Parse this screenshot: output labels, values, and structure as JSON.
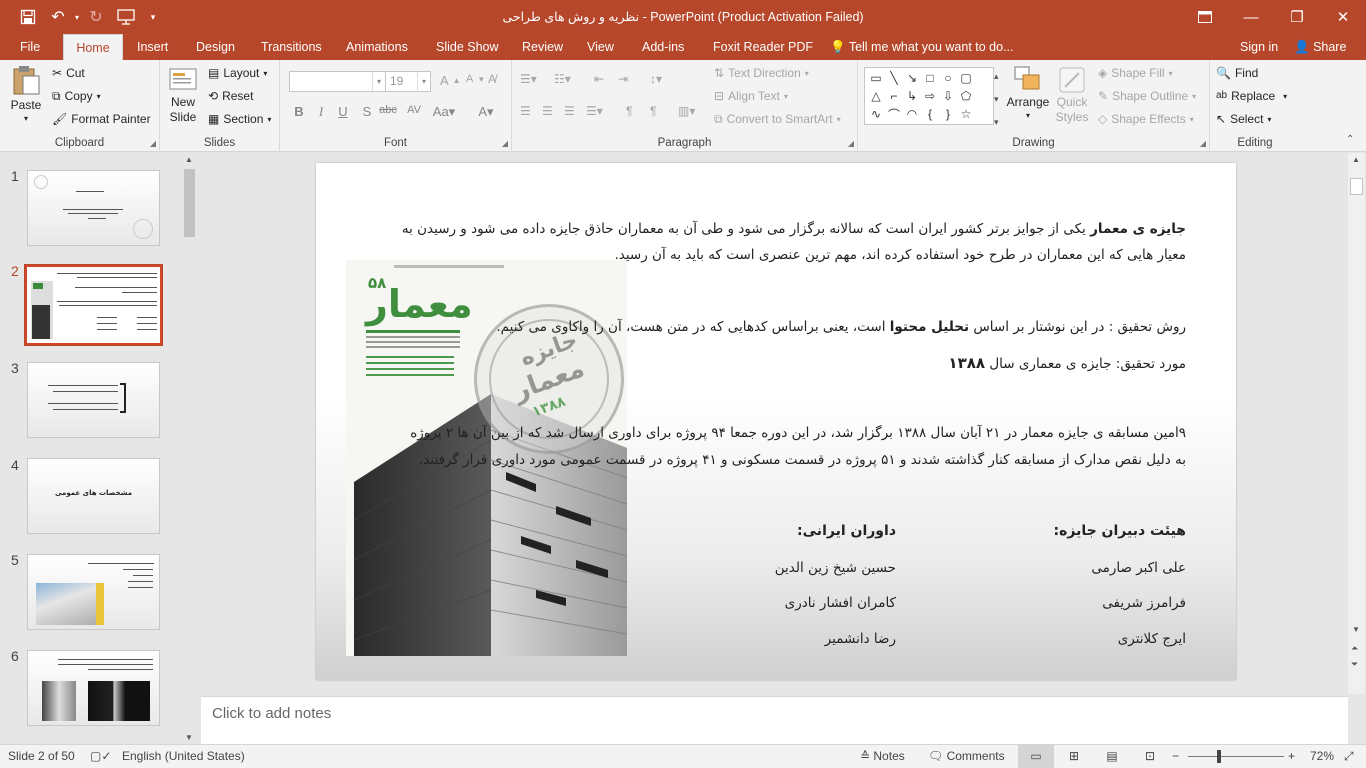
{
  "window": {
    "title": "نظریه و روش های طراحی - PowerPoint (Product Activation Failed)",
    "accent": "#b7472a"
  },
  "tabs": {
    "file": "File",
    "items": [
      "Home",
      "Insert",
      "Design",
      "Transitions",
      "Animations",
      "Slide Show",
      "Review",
      "View",
      "Add-ins",
      "Foxit Reader PDF"
    ],
    "active": "Home",
    "tell_me": "Tell me what you want to do...",
    "sign_in": "Sign in",
    "share": "Share"
  },
  "ribbon": {
    "clipboard": {
      "label": "Clipboard",
      "paste": "Paste",
      "cut": "Cut",
      "copy": "Copy",
      "format_painter": "Format Painter"
    },
    "slides": {
      "label": "Slides",
      "new_slide_1": "New",
      "new_slide_2": "Slide",
      "layout": "Layout",
      "reset": "Reset",
      "section": "Section"
    },
    "font": {
      "label": "Font",
      "size": "19",
      "font_name": ""
    },
    "paragraph": {
      "label": "Paragraph",
      "text_direction": "Text Direction",
      "align_text": "Align Text",
      "smartart": "Convert to SmartArt"
    },
    "drawing": {
      "label": "Drawing",
      "arrange": "Arrange",
      "quick_1": "Quick",
      "quick_2": "Styles",
      "shape_fill": "Shape Fill",
      "shape_outline": "Shape Outline",
      "shape_effects": "Shape Effects"
    },
    "editing": {
      "label": "Editing",
      "find": "Find",
      "replace": "Replace",
      "select": "Select"
    }
  },
  "thumbnails": {
    "numbers": [
      "1",
      "2",
      "3",
      "4",
      "5",
      "6"
    ],
    "selected": "2",
    "slide4_title": "مشخصات های عمومی"
  },
  "slide": {
    "p1_bold": "جایزه ی معمار",
    "p1_rest": " یکی از جوایز برتر کشور ایران است که سالانه  برگزار می شود و طی آن به معماران حاذق جایزه داده می شود و رسیدن به",
    "p1_line2": "معیار هایی که این معماران در طرح خود استفاده کرده اند، مهم ترین عنصری است که باید به آن رسید.",
    "p2_a": "روش تحقیق : در این نوشتار بر اساس ",
    "p2_bold": "تحلیل محتوا",
    "p2_b": " است، یعنی براساس کدهایی که در متن هست، آن را واکاوی می کنیم.",
    "p3_a": "مورد تحقیق: جایزه ی معماری سال ",
    "p3_bold": "۱۳۸۸",
    "p4_line1": "۹امین مسابقه ی جایزه معمار در ۲۱ آبان سال ۱۳۸۸ برگزار شد، در این دوره جمعا ۹۴ پروژه برای داوری ارسال شد که از بین آن ها ۲ پروژه",
    "p4_line2": "به دلیل نقص مدارک از مسابقه کنار گذاشته شدند و ۵۱ پروژه در قسمت مسکونی و ۴۱ پروژه در قسمت عمومی مورد داوری قرار گرفتند.",
    "secretaries_heading": "هیئت دبیران جایزه:",
    "secretaries": [
      "علی اکبر صارمی",
      "فرامرز شریفی",
      "ایرج کلانتری"
    ],
    "judges_heading": "داوران ایرانی:",
    "judges": [
      "حسین شیخ زین الدین",
      "کامران افشار نادری",
      "رضا دانشمیر"
    ],
    "poster": {
      "issue": "۵۸",
      "name": "معمار",
      "seal_1": "جایزه",
      "seal_2": "معمار",
      "seal_year": "۱۳۸۸"
    }
  },
  "notes_placeholder": "Click to add notes",
  "status": {
    "slide_of": "Slide 2 of 50",
    "language": "English (United States)",
    "notes": "Notes",
    "comments": "Comments",
    "zoom": "72%"
  }
}
